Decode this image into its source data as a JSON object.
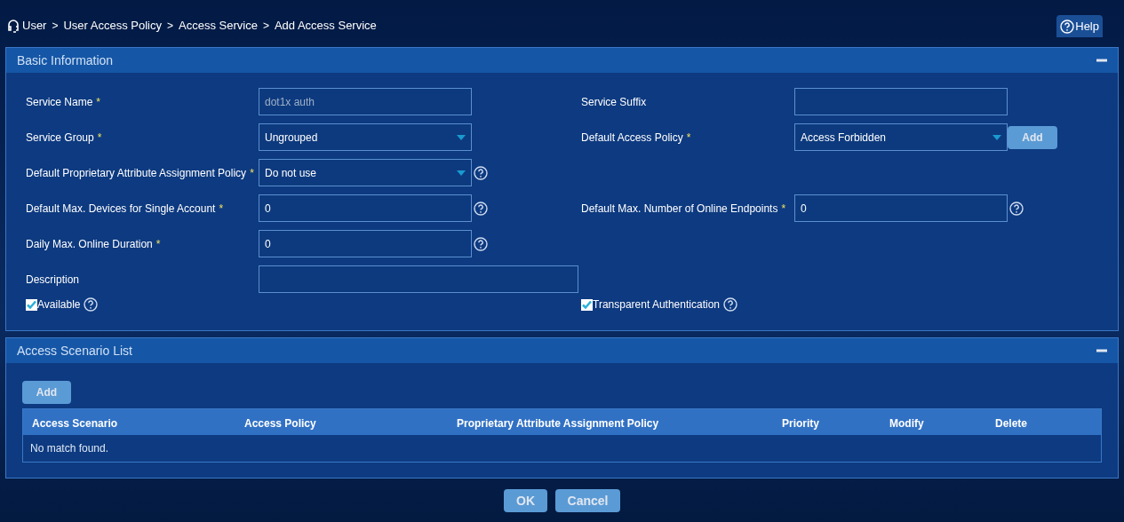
{
  "breadcrumb": [
    {
      "text": "User"
    },
    {
      "separator": ">",
      "text": "User Access Policy"
    },
    {
      "separator": ">",
      "text": "Access Service"
    },
    {
      "separator": ">",
      "text": "Add Access Service"
    }
  ],
  "help_button": "Help",
  "basic_information": {
    "title": "Basic Information",
    "expanded": true,
    "rows": [
      {
        "left": {
          "label": "Service Name",
          "required_mark": "*",
          "kind": "text",
          "value": "dot1x auth",
          "disabled": true,
          "help": false
        },
        "right": {
          "label": "Service Suffix",
          "kind": "text",
          "disabled": false,
          "help": false
        }
      },
      {
        "left": {
          "label": "Service Group",
          "required_mark": "*",
          "kind": "select",
          "value": "Ungrouped",
          "help": false
        },
        "right": {
          "label": "Default Access Policy",
          "required_mark": "*",
          "kind": "select",
          "value": "Access Forbidden",
          "help": false,
          "button": "Add"
        }
      },
      {
        "left": {
          "label": "Default Proprietary Attribute Assignment Policy",
          "required_mark": "*",
          "kind": "select",
          "value": "Do not use",
          "help": true
        }
      },
      {
        "left": {
          "label": "Default Max. Devices for Single Account",
          "required_mark": "*",
          "kind": "text",
          "value": "0",
          "disabled": false,
          "help": true
        },
        "right": {
          "label": "Default Max. Number of Online Endpoints",
          "required_mark": "*",
          "kind": "text",
          "value": "0",
          "disabled": false,
          "help": true
        }
      },
      {
        "left": {
          "label": "Daily Max. Online Duration",
          "required_mark": "*",
          "kind": "text",
          "value": "0",
          "disabled": false,
          "help": true
        }
      },
      {
        "left": {
          "label": "Description",
          "kind": "wide",
          "disabled": false,
          "help": false
        }
      }
    ],
    "checkboxes": [
      {
        "label": "Available",
        "checked": true,
        "help": true
      },
      {
        "label": "Transparent Authentication",
        "checked": true,
        "help": true
      }
    ]
  },
  "access_scenario_list": {
    "title": "Access Scenario List",
    "expanded": true,
    "add_button": "Add",
    "table": {
      "columns": [
        "Access Scenario",
        "Access Policy",
        "Proprietary Attribute Assignment Policy",
        "Priority",
        "Modify",
        "Delete"
      ],
      "empty_message": "No match found."
    }
  },
  "buttons": [
    "OK",
    "Cancel"
  ]
}
